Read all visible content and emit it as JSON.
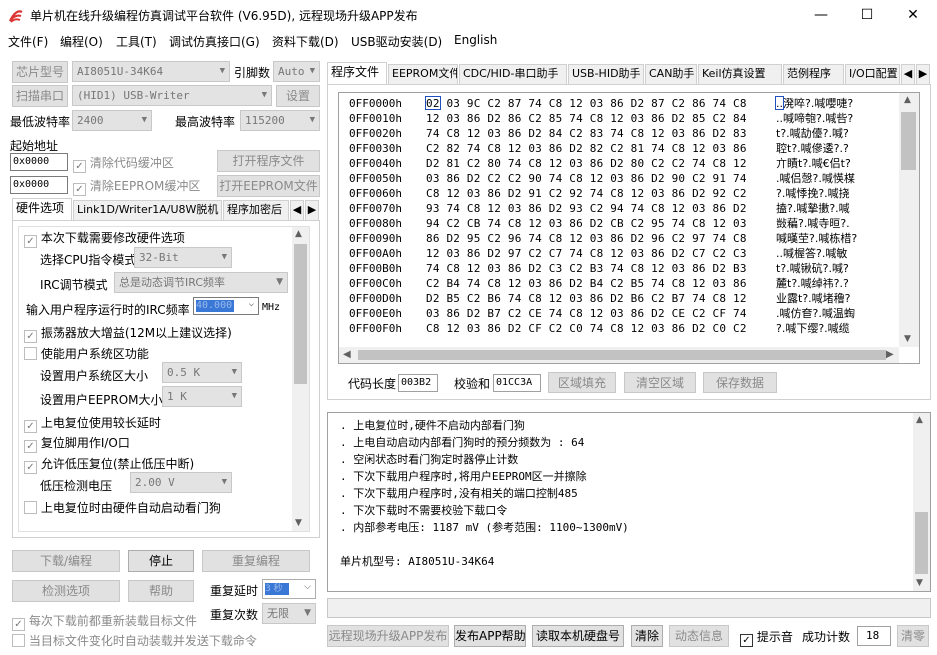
{
  "window": {
    "title": "单片机在线升级编程仿真调试平台软件 (V6.95D), 远程现场升级APP发布",
    "minimize": "—",
    "maximize": "☐",
    "close": "✕"
  },
  "menu": [
    "文件(F)",
    "编程(O)",
    "工具(T)",
    "调试仿真接口(G)",
    "资料下载(D)",
    "USB驱动安装(D)",
    "English"
  ],
  "left": {
    "chip_model_btn": "芯片型号",
    "chip_model_value": "AI8051U-34K64",
    "pin_label": "引脚数",
    "pin_value": "Auto",
    "scan_btn": "扫描串口",
    "port_value": "(HID1) USB-Writer",
    "settings_btn": "设置",
    "min_baud_label": "最低波特率",
    "min_baud_value": "2400",
    "max_baud_label": "最高波特率",
    "max_baud_value": "115200",
    "start_addr_label": "起始地址",
    "addr1": "0x0000",
    "clear_code_label": "清除代码缓冲区",
    "open_prog_btn": "打开程序文件",
    "addr2": "0x0000",
    "clear_eeprom_label": "清除EEPROM缓冲区",
    "open_eeprom_btn": "打开EEPROM文件",
    "tabs": [
      "硬件选项",
      "Link1D/Writer1A/U8W脱机",
      "程序加密后"
    ],
    "hw": {
      "opt_modify": "本次下载需要修改硬件选项",
      "cpu_mode_label": "选择CPU指令模式",
      "cpu_mode_value": "32-Bit",
      "irc_mode_label": "IRC调节模式",
      "irc_mode_value": "总是动态调节IRC频率",
      "irc_freq_label": "输入用户程序运行时的IRC频率",
      "irc_freq_value": "40.000",
      "mhz": "MHz",
      "osc_gain": "振荡器放大增益(12M以上建议选择)",
      "user_sys": "使能用户系统区功能",
      "user_sys_size_label": "设置用户系统区大小",
      "user_sys_size_value": "0.5 K",
      "user_eeprom_label": "设置用户EEPROM大小",
      "user_eeprom_value": "1  K",
      "long_delay": "上电复位使用较长延时",
      "reset_io": "复位脚用作I/O口",
      "low_volt_reset": "允许低压复位(禁止低压中断)",
      "low_volt_label": "低压检测电压",
      "low_volt_value": "2.00 V",
      "wdt_auto": "上电复位时由硬件自动启动看门狗"
    },
    "download_btn": "下载/编程",
    "stop_btn": "停止",
    "reprog_btn": "重复编程",
    "detect_btn": "检测选项",
    "help_btn": "帮助",
    "repeat_delay_label": "重复延时",
    "repeat_delay_value": "3 秒",
    "repeat_count_label": "重复次数",
    "repeat_count_value": "无限",
    "reload_label": "每次下载前都重新装载目标文件",
    "auto_send_label": "当目标文件变化时自动装载并发送下载命令"
  },
  "right": {
    "tabs": [
      "程序文件",
      "EEPROM文件",
      "CDC/HID-串口助手",
      "USB-HID助手",
      "CAN助手",
      "Keil仿真设置",
      "范例程序",
      "I/O口配置"
    ],
    "hex_rows": [
      {
        "addr": "0FF0000h",
        "bytes": "02 03 9C C2 87 74 C8 12 03 86 D2 87 C2 86 74 C8",
        "ascii": "..溌啐?.喊嚶啑?"
      },
      {
        "addr": "0FF0010h",
        "bytes": "12 03 86 D2 86 C2 85 74 C8 12 03 86 D2 85 C2 84",
        "ascii": "..喊啼匏?.喊呰?"
      },
      {
        "addr": "0FF0020h",
        "bytes": "74 C8 12 03 86 D2 84 C2 83 74 C8 12 03 86 D2 83",
        "ascii": "t?.喊劼儓?.喊?"
      },
      {
        "addr": "0FF0030h",
        "bytes": "C2 82 74 C8 12 03 86 D2 82 C2 81 74 C8 12 03 86",
        "ascii": "聜t?.喊傪逶?.?"
      },
      {
        "addr": "0FF0040h",
        "bytes": "D2 81 C2 80 74 C8 12 03 86 D2 80 C2 C2 74 C8 12",
        "ascii": "亣瞔t?.喊€侣t?"
      },
      {
        "addr": "0FF0050h",
        "bytes": "03 86 D2 C2 C2 90 74 C8 12 03 86 D2 90 C2 91 74",
        "ascii": ".喊侣愨?.喊愥楳"
      },
      {
        "addr": "0FF0060h",
        "bytes": "C8 12 03 86 D2 91 C2 92 74 C8 12 03 86 D2 92 C2",
        "ascii": "?.喊悸挽?.喊挠"
      },
      {
        "addr": "0FF0070h",
        "bytes": "93 74 C8 12 03 86 D2 93 C2 94 74 C8 12 03 86 D2",
        "ascii": "搕?.喊摯擻?.喊"
      },
      {
        "addr": "0FF0080h",
        "bytes": "94 C2 CB 74 C8 12 03 86 D2 CB C2 95 74 C8 12 03",
        "ascii": "敱藊?.喊寺晅?."
      },
      {
        "addr": "0FF0090h",
        "bytes": "86 D2 95 C2 96 74 C8 12 03 86 D2 96 C2 97 74 C8",
        "ascii": "喊暵茔?.喊栋棤?"
      },
      {
        "addr": "0FF00A0h",
        "bytes": "12 03 86 D2 97 C2 C7 74 C8 12 03 86 D2 C7 C2 C3",
        "ascii": "..喊楃答?.喊敏"
      },
      {
        "addr": "0FF00B0h",
        "bytes": "74 C8 12 03 86 D2 C3 C2 B3 74 C8 12 03 86 D2 B3",
        "ascii": "t?.喊锹砊?.喊?"
      },
      {
        "addr": "0FF00C0h",
        "bytes": "C2 B4 74 C8 12 03 86 D2 B4 C2 B5 74 C8 12 03 86",
        "ascii": "麓t?.喊绰祎?.?"
      },
      {
        "addr": "0FF00D0h",
        "bytes": "D2 B5 C2 B6 74 C8 12 03 86 D2 B6 C2 B7 74 C8 12",
        "ascii": "业露t?.喊堵穞?"
      },
      {
        "addr": "0FF00E0h",
        "bytes": "03 86 D2 B7 C2 CE 74 C8 12 03 86 D2 CE C2 CF 74",
        "ascii": ".喊仿奆?.喊温蜪"
      },
      {
        "addr": "0FF00F0h",
        "bytes": "C8 12 03 86 D2 CF C2 C0 74 C8 12 03 86 D2 C0 C2",
        "ascii": "?.喊下缨?.喊缆"
      }
    ],
    "code_len_label": "代码长度",
    "code_len_value": "003B2",
    "checksum_label": "校验和",
    "checksum_value": "01CC3A",
    "fill_btn": "区域填充",
    "clear_btn": "清空区域",
    "save_btn": "保存数据",
    "status_lines": [
      ". 上电复位时,硬件不启动内部看门狗",
      ". 上电自动启动内部看门狗时的预分频数为 : 64",
      ". 空闲状态时看门狗定时器停止计数",
      ". 下次下载用户程序时,将用户EEPROM区一并擦除",
      ". 下次下载用户程序时,没有相关的端口控制485",
      ". 下次下载时不需要校验下载口令",
      ". 内部参考电压: 1187 mV (参考范围: 1100~1300mV)",
      "",
      "单片机型号: AI8051U-34K64"
    ],
    "publish_btn": "远程现场升级APP发布",
    "publish_help_btn": "发布APP帮助",
    "read_disk_btn": "读取本机硬盘号",
    "clear2_btn": "清除",
    "dyn_info_btn": "动态信息",
    "beep_label": "提示音",
    "success_label": "成功计数",
    "success_value": "18",
    "clear_count_btn": "清零"
  }
}
